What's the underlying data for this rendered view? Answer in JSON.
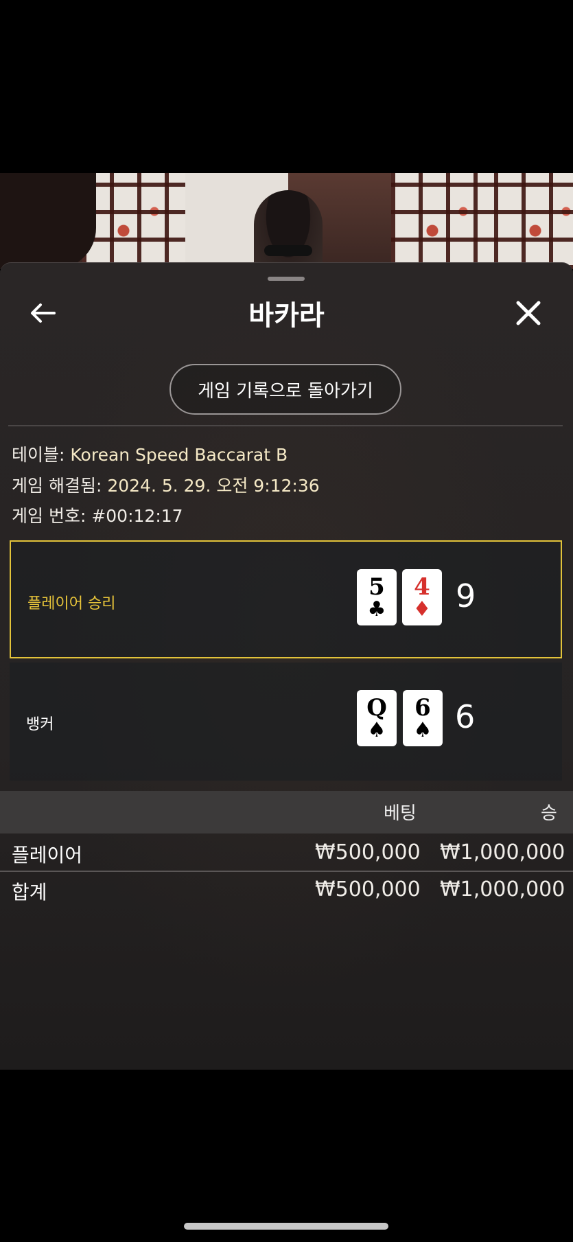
{
  "header": {
    "title": "바카라",
    "history_button": "게임 기록으로 돌아가기"
  },
  "meta": {
    "table_label": "테이블:",
    "table_value": "Korean Speed Baccarat B",
    "resolved_label": "게임 해결됨:",
    "resolved_value": "2024. 5. 29. 오전 9:12:36",
    "round_label": "게임 번호:",
    "round_value": "#00:12:17"
  },
  "hands": {
    "player": {
      "label": "플레이어 승리",
      "cards": [
        {
          "rank": "5",
          "suit": "♣"
        },
        {
          "rank": "4",
          "suit": "♦"
        }
      ],
      "total": "9"
    },
    "banker": {
      "label": "뱅커",
      "cards": [
        {
          "rank": "Q",
          "suit": "♠"
        },
        {
          "rank": "6",
          "suit": "♠"
        }
      ],
      "total": "6"
    }
  },
  "bets_table": {
    "headers": {
      "bet": "베팅",
      "win": "승"
    },
    "rows": [
      {
        "label": "플레이어",
        "bet": "₩500,000",
        "win": "₩1,000,000"
      }
    ],
    "total": {
      "label": "합계",
      "bet": "₩500,000",
      "win": "₩1,000,000"
    }
  },
  "icons": {
    "back": "arrow-left-icon",
    "close": "close-icon"
  },
  "colors": {
    "winner_border": "#e2c33a",
    "winner_text": "#e8c53a",
    "card_red": "#d6302c"
  }
}
